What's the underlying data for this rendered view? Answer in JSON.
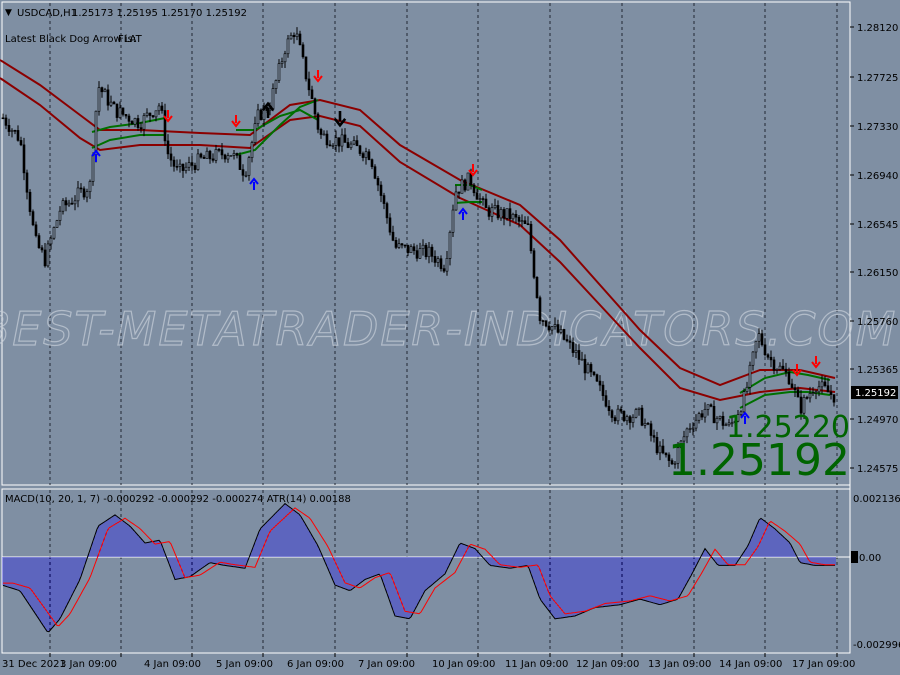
{
  "symbol_header": {
    "symbol": "USDCAD,H1",
    "ohlc": "1.25173 1.25195 1.25170 1.25192"
  },
  "status_line": {
    "label": "Latest Black Dog Arrow is:",
    "value": "FLAT"
  },
  "watermark": "BEST-METATRADER-INDICATORS.COM",
  "price_axis": {
    "ticks": [
      "1.28120",
      "1.27725",
      "1.27330",
      "1.26940",
      "1.26545",
      "1.26150",
      "1.25760",
      "1.25365",
      "1.24970",
      "1.24575"
    ],
    "current_price": "1.25192"
  },
  "big_prices": {
    "upper": "1.25220",
    "lower": "1.25192"
  },
  "indicator_header": "MACD(10, 20, 1, 7) -0.000292 -0.000292 -0.000274  ATR(14) 0.00188",
  "indicator_axis": {
    "top": "0.002136",
    "zero": "0.00",
    "bottom": "-0.002996"
  },
  "time_axis": [
    "31 Dec 2021",
    "3 Jan 09:00",
    "4 Jan 09:00",
    "5 Jan 09:00",
    "6 Jan 09:00",
    "7 Jan 09:00",
    "10 Jan 09:00",
    "11 Jan 09:00",
    "12 Jan 09:00",
    "13 Jan 09:00",
    "14 Jan 09:00",
    "17 Jan 09:00"
  ],
  "colors": {
    "background": "#7f8fa3",
    "grid": "#2a2f3a",
    "candle": "#000000",
    "band_upper": "#8b0000",
    "band_lower": "#8b0000",
    "signal_line": "#006400",
    "arrow_buy": "#0000ff",
    "arrow_sell": "#ff0000",
    "macd_hist": "#3b3bd9",
    "macd_signal": "#ff0000",
    "big_price": "#006400"
  },
  "chart_data": {
    "type": "candlestick",
    "symbol": "USDCAD",
    "timeframe": "H1",
    "price_closes": [
      1.273,
      1.2718,
      1.27,
      1.266,
      1.261,
      1.264,
      1.2665,
      1.268,
      1.269,
      1.27,
      1.276,
      1.2745,
      1.274,
      1.2735,
      1.274,
      1.272,
      1.273,
      1.2745,
      1.2695,
      1.27,
      1.2715,
      1.2705,
      1.271,
      1.2715,
      1.27,
      1.274,
      1.275,
      1.276,
      1.278,
      1.28,
      1.279,
      1.276,
      1.274,
      1.2725,
      1.272,
      1.2715,
      1.271,
      1.2715,
      1.27,
      1.265,
      1.2635,
      1.264,
      1.263,
      1.2625,
      1.265,
      1.269,
      1.2685,
      1.267,
      1.266,
      1.2655,
      1.265,
      1.262,
      1.258,
      1.256,
      1.254,
      1.253,
      1.251,
      1.25,
      1.25,
      1.2495,
      1.248,
      1.247,
      1.248,
      1.25,
      1.251,
      1.249,
      1.248,
      1.2495,
      1.2525,
      1.2545,
      1.2535,
      1.253,
      1.2525,
      1.251,
      1.251,
      1.2505,
      1.2519
    ],
    "macd_range": [
      -0.002996,
      0.002136
    ]
  }
}
